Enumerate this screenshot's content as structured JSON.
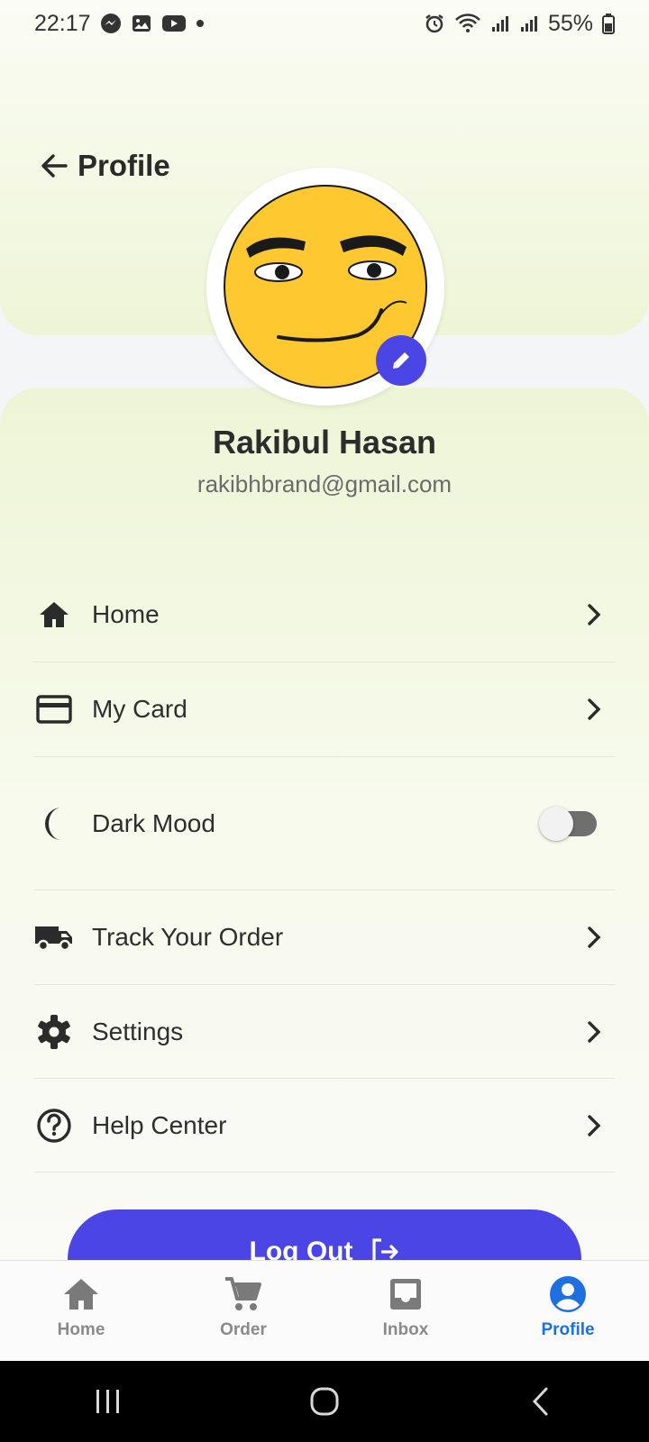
{
  "status_bar": {
    "time": "22:17",
    "left_icons": [
      "messenger-icon",
      "gallery-icon",
      "youtube-icon",
      "dot-icon"
    ],
    "right_icons": [
      "alarm-icon",
      "wifi-icon",
      "signal-icon",
      "signal-icon"
    ],
    "battery": "55%"
  },
  "header": {
    "title": "Profile"
  },
  "profile": {
    "name": "Rakibul Hasan",
    "email": "rakibhbrand@gmail.com"
  },
  "menu": {
    "items": [
      {
        "label": "Home",
        "icon": "home-icon",
        "type": "link"
      },
      {
        "label": "My Card",
        "icon": "credit-card-icon",
        "type": "link"
      },
      {
        "label": "Dark Mood",
        "icon": "moon-icon",
        "type": "toggle",
        "enabled": false
      },
      {
        "label": "Track Your Order",
        "icon": "truck-icon",
        "type": "link"
      },
      {
        "label": "Settings",
        "icon": "gear-icon",
        "type": "link"
      },
      {
        "label": "Help Center",
        "icon": "help-icon",
        "type": "link"
      }
    ]
  },
  "logout": {
    "label": "Log Out"
  },
  "bottom_nav": {
    "items": [
      {
        "label": "Home",
        "icon": "home-icon"
      },
      {
        "label": "Order",
        "icon": "cart-icon"
      },
      {
        "label": "Inbox",
        "icon": "inbox-icon"
      },
      {
        "label": "Profile",
        "icon": "profile-icon",
        "active": true
      }
    ]
  },
  "colors": {
    "accent": "#4b45e6",
    "active_nav": "#1e6fe0",
    "panel_tint": "#eef5d6"
  }
}
